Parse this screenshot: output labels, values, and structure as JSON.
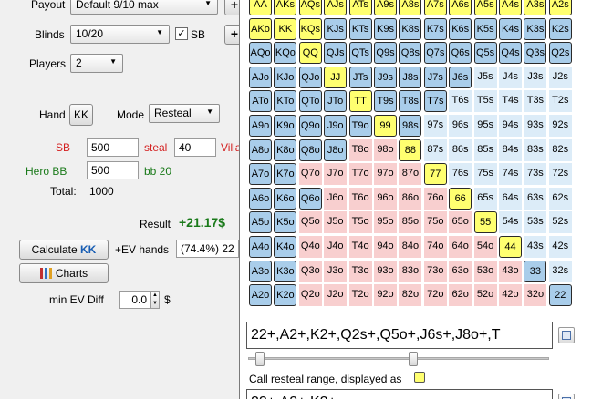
{
  "left": {
    "payout_label": "Payout",
    "payout_value": "Default 9/10 max",
    "blinds_label": "Blinds",
    "blinds_value": "10/20",
    "sb_label": "SB",
    "players_label": "Players",
    "players_value": "2",
    "hand_label": "Hand",
    "hand_value": "KK",
    "mode_label": "Mode",
    "mode_value": "Resteal",
    "sb_row_label": "SB",
    "sb_stack": "500",
    "steal_label": "steal",
    "steal_value": "40",
    "villain_label": "Villa",
    "hero_label": "Hero BB",
    "hero_stack": "500",
    "bb_label": "bb 20",
    "total_label": "Total:",
    "total_value": "1000",
    "result_label": "Result",
    "result_value": "+21.17$",
    "calculate_label": "Calculate",
    "calculate_hand": "KK",
    "ev_hands_label": "+EV hands",
    "ev_hands_value": "(74.4%) 22",
    "charts_label": "Charts",
    "min_ev_label": "min EV Diff",
    "min_ev_value": "0.0",
    "min_ev_unit": "$",
    "plus_label": "+"
  },
  "right": {
    "range_text": "22+,A2+,K2+,Q2s+,Q5o+,J6s+,J8o+,T",
    "call_label": "Call resteal range, displayed as",
    "bottom_text": "22+,A2+,K2+,..."
  },
  "colors": {
    "blue": "#a9cdea",
    "yellow": "#ffff70",
    "pink": "#f8cfcf",
    "lightblue": "#dcecf8"
  },
  "grid": {
    "rows": [
      [
        "AA",
        "AKs",
        "AQs",
        "AJs",
        "ATs",
        "A9s",
        "A8s",
        "A7s",
        "A6s",
        "A5s",
        "A4s",
        "A3s",
        "A2s"
      ],
      [
        "AKo",
        "KK",
        "KQs",
        "KJs",
        "KTs",
        "K9s",
        "K8s",
        "K7s",
        "K6s",
        "K5s",
        "K4s",
        "K3s",
        "K2s"
      ],
      [
        "AQo",
        "KQo",
        "QQ",
        "QJs",
        "QTs",
        "Q9s",
        "Q8s",
        "Q7s",
        "Q6s",
        "Q5s",
        "Q4s",
        "Q3s",
        "Q2s"
      ],
      [
        "AJo",
        "KJo",
        "QJo",
        "JJ",
        "JTs",
        "J9s",
        "J8s",
        "J7s",
        "J6s",
        "J5s",
        "J4s",
        "J3s",
        "J2s"
      ],
      [
        "ATo",
        "KTo",
        "QTo",
        "JTo",
        "TT",
        "T9s",
        "T8s",
        "T7s",
        "T6s",
        "T5s",
        "T4s",
        "T3s",
        "T2s"
      ],
      [
        "A9o",
        "K9o",
        "Q9o",
        "J9o",
        "T9o",
        "99",
        "98s",
        "97s",
        "96s",
        "95s",
        "94s",
        "93s",
        "92s"
      ],
      [
        "A8o",
        "K8o",
        "Q8o",
        "J8o",
        "T8o",
        "98o",
        "88",
        "87s",
        "86s",
        "85s",
        "84s",
        "83s",
        "82s"
      ],
      [
        "A7o",
        "K7o",
        "Q7o",
        "J7o",
        "T7o",
        "97o",
        "87o",
        "77",
        "76s",
        "75s",
        "74s",
        "73s",
        "72s"
      ],
      [
        "A6o",
        "K6o",
        "Q6o",
        "J6o",
        "T6o",
        "96o",
        "86o",
        "76o",
        "66",
        "65s",
        "64s",
        "63s",
        "62s"
      ],
      [
        "A5o",
        "K5o",
        "Q5o",
        "J5o",
        "T5o",
        "95o",
        "85o",
        "75o",
        "65o",
        "55",
        "54s",
        "53s",
        "52s"
      ],
      [
        "A4o",
        "K4o",
        "Q4o",
        "J4o",
        "T4o",
        "94o",
        "84o",
        "74o",
        "64o",
        "54o",
        "44",
        "43s",
        "42s"
      ],
      [
        "A3o",
        "K3o",
        "Q3o",
        "J3o",
        "T3o",
        "93o",
        "83o",
        "73o",
        "63o",
        "53o",
        "43o",
        "33",
        "32s"
      ],
      [
        "A2o",
        "K2o",
        "Q2o",
        "J2o",
        "T2o",
        "92o",
        "82o",
        "72o",
        "62o",
        "52o",
        "42o",
        "32o",
        "22"
      ]
    ],
    "cell_types": [
      [
        "Y",
        "Y",
        "Y",
        "Y",
        "Y",
        "Y",
        "Y",
        "Y",
        "Y",
        "Y",
        "Y",
        "Y",
        "Y"
      ],
      [
        "Y",
        "Y",
        "Y",
        "B",
        "B",
        "B",
        "B",
        "B",
        "B",
        "B",
        "B",
        "B",
        "B"
      ],
      [
        "B",
        "B",
        "Y",
        "B",
        "B",
        "B",
        "B",
        "B",
        "B",
        "B",
        "B",
        "B",
        "B"
      ],
      [
        "B",
        "B",
        "B",
        "Y",
        "B",
        "B",
        "B",
        "B",
        "B",
        "L",
        "L",
        "L",
        "L"
      ],
      [
        "B",
        "B",
        "B",
        "B",
        "Y",
        "B",
        "B",
        "B",
        "L",
        "L",
        "L",
        "L",
        "L"
      ],
      [
        "B",
        "B",
        "B",
        "B",
        "B",
        "Y",
        "B",
        "L",
        "L",
        "L",
        "L",
        "L",
        "L"
      ],
      [
        "B",
        "B",
        "B",
        "B",
        "P",
        "P",
        "Y",
        "L",
        "L",
        "L",
        "L",
        "L",
        "L"
      ],
      [
        "B",
        "B",
        "P",
        "P",
        "P",
        "P",
        "P",
        "Y",
        "L",
        "L",
        "L",
        "L",
        "L"
      ],
      [
        "B",
        "B",
        "B",
        "P",
        "P",
        "P",
        "P",
        "P",
        "Y",
        "L",
        "L",
        "L",
        "L"
      ],
      [
        "B",
        "B",
        "P",
        "P",
        "P",
        "P",
        "P",
        "P",
        "P",
        "Y",
        "L",
        "L",
        "L"
      ],
      [
        "B",
        "B",
        "P",
        "P",
        "P",
        "P",
        "P",
        "P",
        "P",
        "P",
        "Y",
        "L",
        "L"
      ],
      [
        "B",
        "B",
        "P",
        "P",
        "P",
        "P",
        "P",
        "P",
        "P",
        "P",
        "P",
        "B",
        "L"
      ],
      [
        "B",
        "B",
        "P",
        "P",
        "P",
        "P",
        "P",
        "P",
        "P",
        "P",
        "P",
        "P",
        "B"
      ]
    ]
  }
}
